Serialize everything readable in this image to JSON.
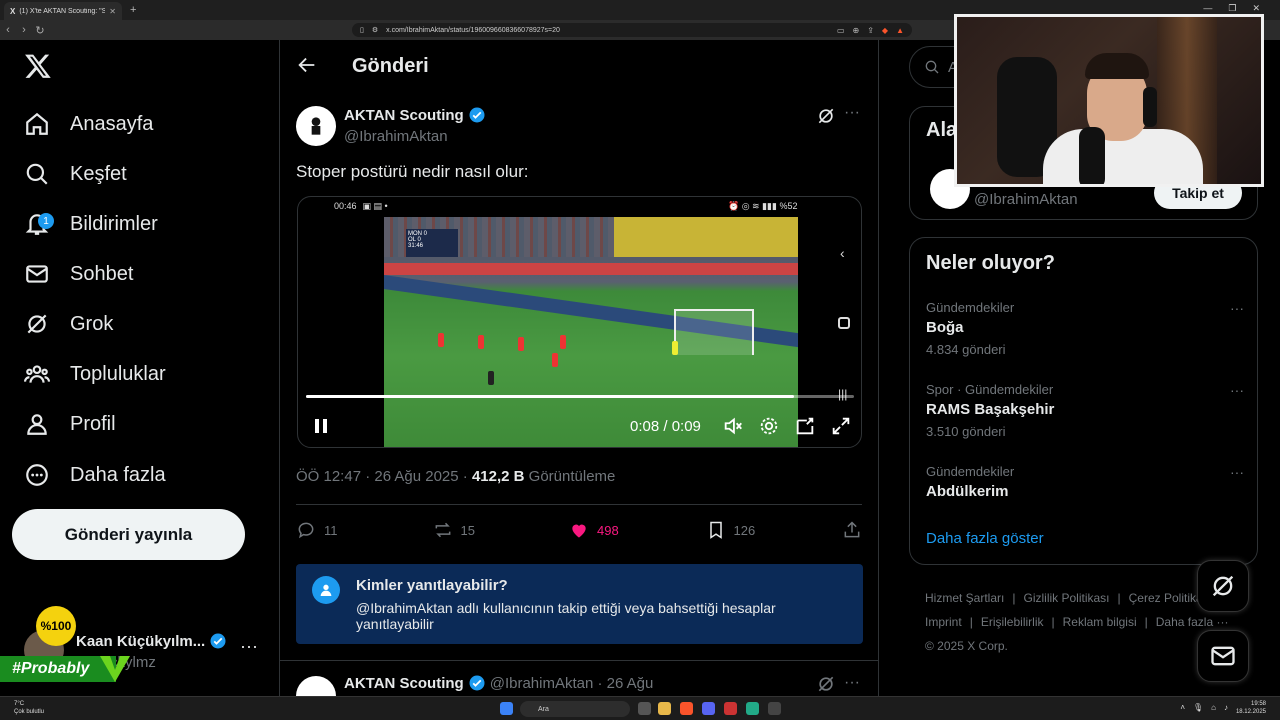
{
  "browser": {
    "tab_title": "(1) X'te AKTAN Scouting: \"Stoper...",
    "url": "x.com/IbrahimAktan/status/1960096608366078927s=20",
    "new_tab": "+",
    "win_min": "—",
    "win_max": "❐",
    "win_close": "✕"
  },
  "nav": {
    "items": [
      {
        "label": "Anasayfa"
      },
      {
        "label": "Keşfet"
      },
      {
        "label": "Bildirimler",
        "badge": "1"
      },
      {
        "label": "Sohbet"
      },
      {
        "label": "Grok"
      },
      {
        "label": "Topluluklar"
      },
      {
        "label": "Profil"
      },
      {
        "label": "Daha fazla"
      }
    ],
    "post_button": "Gönderi yayınla",
    "account_name": "Kaan Küçükyılm...",
    "account_handle": "ckylmz",
    "overlay_logo": "%100",
    "overlay_tag": "#Probably"
  },
  "main": {
    "title": "Gönderi",
    "post": {
      "author": "AKTAN Scouting",
      "handle": "@IbrahimAktan",
      "text": "Stoper postürü nedir nasıl olur:",
      "video": {
        "phone_time": "00:46",
        "phone_battery": "%52",
        "score_home": "MON",
        "score_away": "OL",
        "score_home_goals": "0",
        "score_away_goals": "0",
        "match_clock": "31:46",
        "time": "0:08 / 0:09",
        "progress": 0.89
      },
      "timestamp": "ÖÖ 12:47 · 26 Ağu 2025 · ",
      "views": "412,2 B",
      "views_label": " Görüntüleme",
      "replies": "11",
      "reposts": "15",
      "likes": "498",
      "bookmarks": "126"
    },
    "reply_box": {
      "title": "Kimler yanıtlayabilir?",
      "desc": "@IbrahimAktan adlı kullanıcının takip ettiği veya bahsettiği hesaplar yanıtlayabilir"
    },
    "next_post": {
      "author": "AKTAN Scouting",
      "handle_date": "@IbrahimAktan · 26 Ağu"
    }
  },
  "right": {
    "search_placeholder": "A",
    "who_follow_title": "Ala",
    "who_follow_handle": "@IbrahimAktan",
    "follow_button": "Takip et",
    "trends_title": "Neler oluyor?",
    "trends": [
      {
        "category": "Gündemdekiler",
        "name": "Boğa",
        "count": "4.834 gönderi"
      },
      {
        "category": "Spor · Gündemdekiler",
        "name": "RAMS Başakşehir",
        "count": "3.510 gönderi"
      },
      {
        "category": "Gündemdekiler",
        "name": "Abdülkerim",
        "count": ""
      }
    ],
    "show_more": "Daha fazla göster",
    "footer": [
      "Hizmet Şartları",
      "Gizlilik Politikası",
      "Çerez Politikası",
      "Imprint",
      "Erişilebilirlik",
      "Reklam bilgisi",
      "Daha fazla ···",
      "© 2025 X Corp."
    ]
  },
  "taskbar": {
    "temp": "7°C",
    "weather": "Çok bulutlu",
    "search": "Ara",
    "time": "19:58",
    "date": "18.12.2025"
  },
  "colors": {
    "accent": "#1d9bf0",
    "like": "#f91880",
    "bg": "#000000",
    "reply_box": "#0b2a57"
  }
}
